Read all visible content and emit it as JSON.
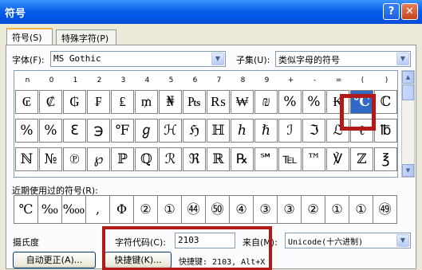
{
  "window": {
    "title": "符号",
    "help_glyph": "?",
    "close_glyph": "✕"
  },
  "tabs": [
    {
      "label": "符号(S)",
      "selected": true
    },
    {
      "label": "特殊字符(P)",
      "selected": false
    }
  ],
  "font": {
    "label": "字体(F):",
    "value": "MS Gothic"
  },
  "subset": {
    "label": "子集(U):",
    "value": "类似字母的符号"
  },
  "grid": {
    "headers": [
      "n",
      "0",
      "1",
      "2",
      "3",
      "4",
      "5",
      "6",
      "7",
      "8",
      "9",
      "+",
      "-",
      "=",
      "(",
      ")"
    ],
    "rows": [
      [
        "₢",
        "₡",
        "₲",
        "₣",
        "₤",
        "₥",
        "₦",
        "₧",
        "₨",
        "₩",
        "₪",
        "%",
        "%",
        "₭",
        "℃",
        "ℂ"
      ],
      [
        "%",
        "%",
        "ℇ",
        "℈",
        "℉",
        "ℊ",
        "ℋ",
        "ℌ",
        "ℍ",
        "ℎ",
        "ℏ",
        "ℐ",
        "ℑ",
        "ℒ",
        "ℓ",
        "℔"
      ],
      [
        "ℕ",
        "№",
        "℗",
        "℘",
        "ℙ",
        "ℚ",
        "ℛ",
        "ℜ",
        "ℝ",
        "℞",
        "℠",
        "℡",
        "™",
        "℣",
        "ℤ",
        "℥"
      ]
    ],
    "selected_char": "℃"
  },
  "recent": {
    "label": "近期使用过的符号(R):",
    "items": [
      "℃",
      "‰",
      "‱",
      ",",
      "Φ",
      "②",
      "①",
      "㊹",
      "㊿",
      "④",
      "③",
      "③",
      "②",
      "①",
      "①",
      "㊾"
    ]
  },
  "char_name": "摄氏度",
  "char_code": {
    "label": "字符代码(C):",
    "value": "2103"
  },
  "from": {
    "label": "来自(M):",
    "value": "Unicode(十六进制)"
  },
  "buttons": {
    "autocorrect": "自动更正(A)...",
    "shortcut_key": "快捷键(K)..."
  },
  "shortcut_text": "快捷键: 2103, Alt+X",
  "colors": {
    "title_bar": "#0a5fe8",
    "selection": "#316ac5",
    "annotation_box": "#b21a1a"
  }
}
